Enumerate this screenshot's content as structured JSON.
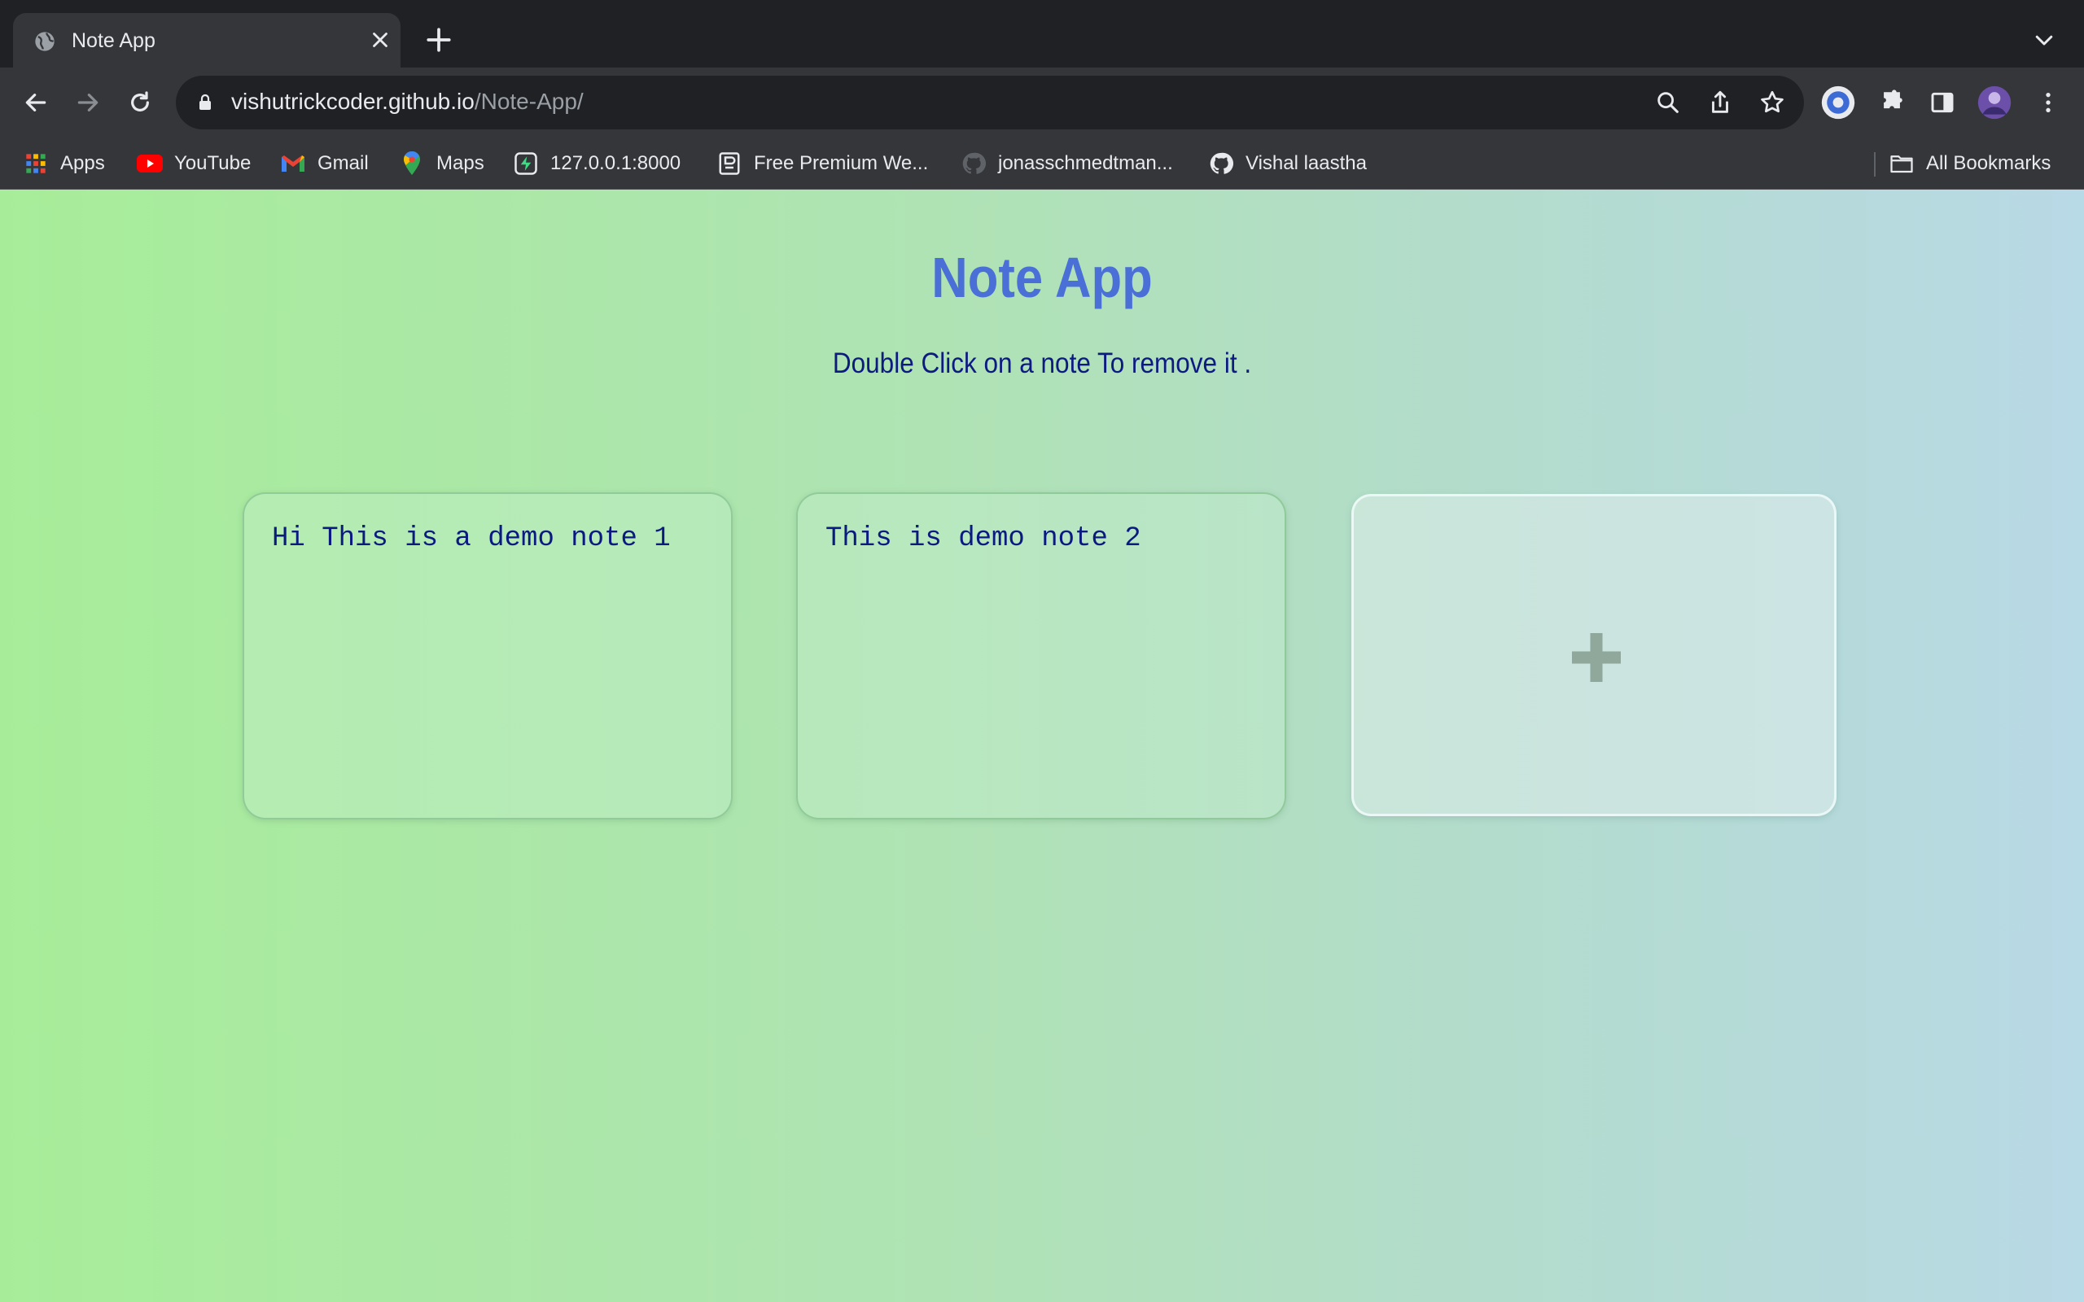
{
  "browser": {
    "tab": {
      "title": "Note App"
    },
    "address": {
      "host": "vishutrickcoder.github.io",
      "path": "/Note-App/"
    },
    "bookmarks": [
      {
        "label": "Apps",
        "icon": "apps-grid-icon"
      },
      {
        "label": "YouTube",
        "icon": "youtube-icon"
      },
      {
        "label": "Gmail",
        "icon": "gmail-icon"
      },
      {
        "label": "Maps",
        "icon": "maps-icon"
      },
      {
        "label": "127.0.0.1:8000",
        "icon": "local-server-icon"
      },
      {
        "label": "Free Premium We...",
        "icon": "premium-icon"
      },
      {
        "label": "jonasschmedtman...",
        "icon": "github-icon"
      },
      {
        "label": "Vishal laastha",
        "icon": "github-icon"
      }
    ],
    "all_bookmarks": "All Bookmarks"
  },
  "app": {
    "title": "Note App",
    "subtitle": "Double Click on a note To remove it .",
    "notes": [
      {
        "text": "Hi This is a demo note 1"
      },
      {
        "text": "This is demo note 2"
      }
    ],
    "add_button_icon": "plus-icon"
  }
}
